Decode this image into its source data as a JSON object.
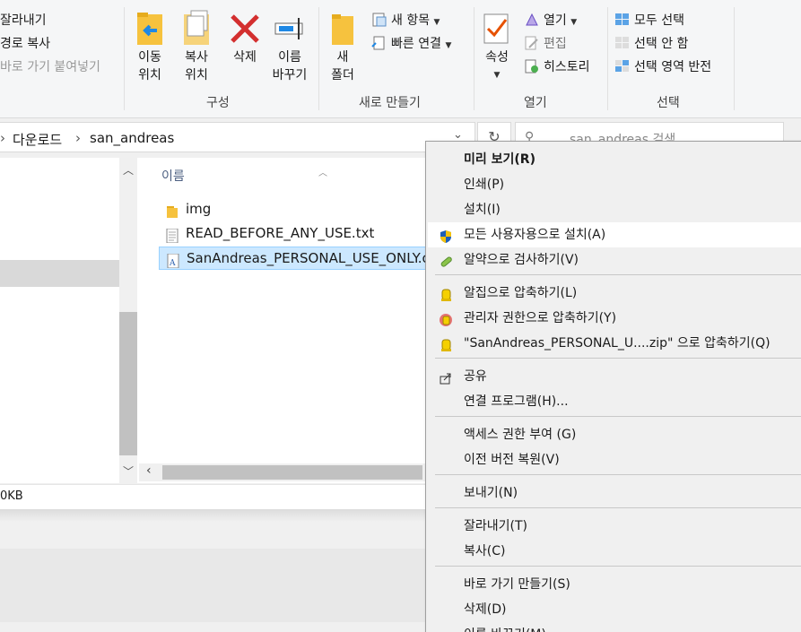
{
  "ribbon": {
    "clipboard_items": [
      "잘라내기",
      "경로 복사",
      "바로 가기 붙여넣기"
    ],
    "organize": {
      "move_to": "이동\n위치",
      "copy_to": "복사\n위치",
      "delete": "삭제",
      "rename": "이름\n바꾸기",
      "group_label": "구성"
    },
    "new": {
      "new_folder": "새\n폴더",
      "new_item": "새 항목",
      "easy_access": "빠른 연결",
      "group_label": "새로 만들기"
    },
    "open": {
      "properties": "속성",
      "open": "열기",
      "edit": "편집",
      "history": "히스토리",
      "group_label": "열기"
    },
    "select": {
      "select_all": "모두 선택",
      "select_none": "선택 안 함",
      "invert": "선택 영역 반전",
      "group_label": "선택"
    }
  },
  "address": {
    "crumbs": [
      "다운로드",
      "san_andreas"
    ],
    "search_placeholder": "san_andreas 검색"
  },
  "files": {
    "column_name": "이름",
    "items": [
      {
        "name": "img",
        "type": "folder"
      },
      {
        "name": "READ_BEFORE_ANY_USE.txt",
        "type": "text"
      },
      {
        "name": "SanAndreas_PERSONAL_USE_ONLY.otf",
        "type": "font",
        "selected": true
      }
    ]
  },
  "status": {
    "size": "0KB"
  },
  "context_menu": {
    "items": [
      {
        "label": "미리 보기(R)",
        "bold": true,
        "icon": ""
      },
      {
        "label": "인쇄(P)",
        "icon": ""
      },
      {
        "label": "설치(I)",
        "icon": ""
      },
      {
        "label": "모든 사용자용으로 설치(A)",
        "icon": "shield-icon",
        "hover": true
      },
      {
        "label": "알약으로 검사하기(V)",
        "icon": "pill-icon"
      },
      {
        "label": "알집으로 압축하기(L)",
        "icon": "alzip-icon"
      },
      {
        "label": "관리자 권한으로 압축하기(Y)",
        "icon": "alzip-admin-icon"
      },
      {
        "label": "\"SanAndreas_PERSONAL_U....zip\" 으로 압축하기(Q)",
        "icon": "alzip-icon"
      },
      {
        "label": "공유",
        "icon": "share-icon"
      },
      {
        "label": "연결 프로그램(H)...",
        "icon": ""
      },
      {
        "label": "액세스 권한 부여 (G)",
        "icon": ""
      },
      {
        "label": "이전 버전 복원(V)",
        "icon": ""
      },
      {
        "label": "보내기(N)",
        "icon": ""
      },
      {
        "label": "잘라내기(T)",
        "icon": ""
      },
      {
        "label": "복사(C)",
        "icon": ""
      },
      {
        "label": "바로 가기 만들기(S)",
        "icon": ""
      },
      {
        "label": "삭제(D)",
        "icon": ""
      },
      {
        "label": "이름 바꾸기(M)",
        "icon": ""
      }
    ]
  }
}
